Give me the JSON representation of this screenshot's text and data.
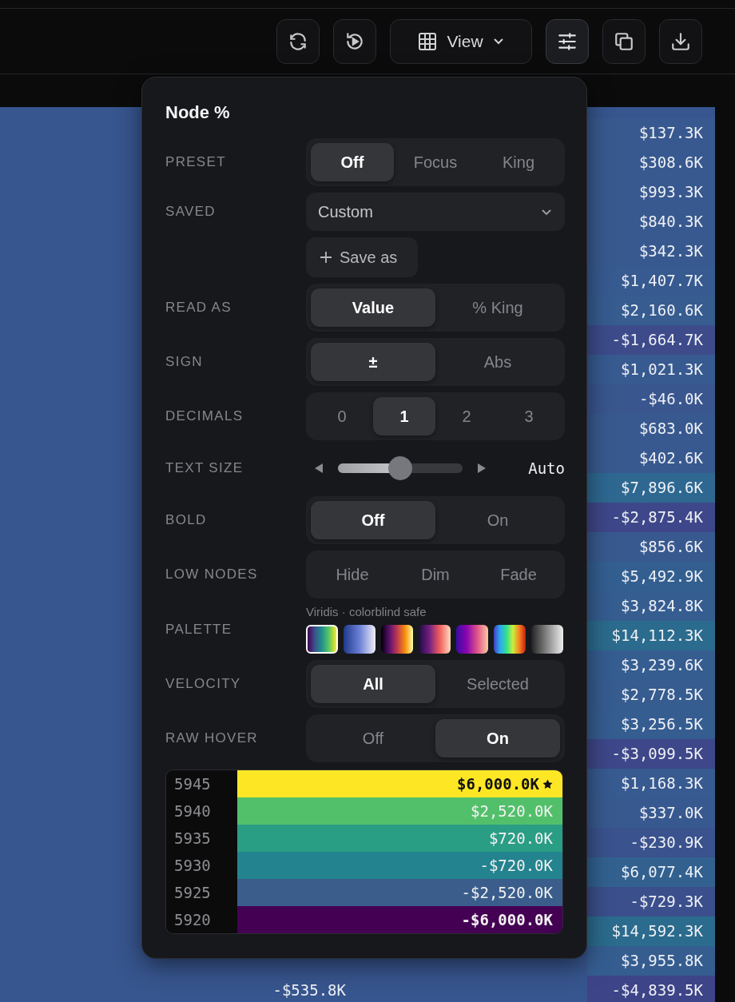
{
  "toolbar": {
    "buttons": [
      {
        "kind": "refresh",
        "selected": false
      },
      {
        "kind": "replay",
        "selected": false
      },
      {
        "kind": "view",
        "label": "View",
        "selected": false
      },
      {
        "kind": "adjust",
        "selected": true
      },
      {
        "kind": "copy",
        "selected": false
      },
      {
        "kind": "download",
        "selected": false
      }
    ]
  },
  "table": {
    "rows": [
      {
        "value": "$137.3K",
        "color": "#38598f"
      },
      {
        "value": "$308.6K",
        "color": "#38598f"
      },
      {
        "value": "$993.3K",
        "color": "#38598f"
      },
      {
        "value": "$840.3K",
        "color": "#38598f"
      },
      {
        "value": "$342.3K",
        "color": "#38598f"
      },
      {
        "value": "$1,407.7K",
        "color": "#375a90"
      },
      {
        "value": "$2,160.6K",
        "color": "#365c90"
      },
      {
        "value": "-$1,664.7K",
        "color": "#3d4b8b"
      },
      {
        "value": "$1,021.3K",
        "color": "#375a90"
      },
      {
        "value": "-$46.0K",
        "color": "#39568e"
      },
      {
        "value": "$683.0K",
        "color": "#38598f"
      },
      {
        "value": "$402.6K",
        "color": "#38598f"
      },
      {
        "value": "$7,896.6K",
        "color": "#2e6891"
      },
      {
        "value": "-$2,875.4K",
        "color": "#3e4789"
      },
      {
        "value": "$856.6K",
        "color": "#38598f"
      },
      {
        "value": "$5,492.9K",
        "color": "#335f90"
      },
      {
        "value": "$3,824.8K",
        "color": "#355d90"
      },
      {
        "value": "$14,112.3K",
        "color": "#2b6b8d"
      },
      {
        "value": "$3,239.6K",
        "color": "#355d90"
      },
      {
        "value": "$2,778.5K",
        "color": "#365c90"
      },
      {
        "value": "$3,256.5K",
        "color": "#355d90"
      },
      {
        "value": "-$3,099.5K",
        "color": "#3e4789"
      },
      {
        "value": "$1,168.3K",
        "color": "#375a90"
      },
      {
        "value": "$337.0K",
        "color": "#38598f"
      },
      {
        "value": "-$230.9K",
        "color": "#3a528d"
      },
      {
        "value": "$6,077.4K",
        "color": "#326190"
      },
      {
        "value": "-$729.3K",
        "color": "#3b4f8c"
      },
      {
        "value": "$14,592.3K",
        "color": "#2b6b8d"
      },
      {
        "value": "$3,955.8K",
        "color": "#355d90"
      },
      {
        "value": "-$4,839.5K",
        "color": "#3e4488",
        "left_value": "-$535.8K"
      }
    ]
  },
  "popover": {
    "title": "Node %",
    "settings": [
      {
        "kind": "segmented",
        "label": "PRESET",
        "options": [
          {
            "label": "Off",
            "selected": true
          },
          {
            "label": "Focus",
            "selected": false
          },
          {
            "label": "King",
            "selected": false
          }
        ]
      },
      {
        "kind": "select",
        "label": "SAVED",
        "value": "Custom"
      },
      {
        "kind": "button",
        "text": "Save as"
      },
      {
        "kind": "segmented",
        "label": "READ AS",
        "options": [
          {
            "label": "Value",
            "selected": true
          },
          {
            "label": "% King",
            "selected": false
          }
        ]
      },
      {
        "kind": "segmented",
        "label": "SIGN",
        "options": [
          {
            "label": "±",
            "selected": true
          },
          {
            "label": "Abs",
            "selected": false
          }
        ]
      },
      {
        "kind": "segmented",
        "label": "DECIMALS",
        "options": [
          {
            "label": "0",
            "selected": false
          },
          {
            "label": "1",
            "selected": true
          },
          {
            "label": "2",
            "selected": false
          },
          {
            "label": "3",
            "selected": false
          }
        ]
      },
      {
        "kind": "slider",
        "label": "TEXT SIZE",
        "level": 0.5,
        "reading": "Auto"
      },
      {
        "kind": "segmented",
        "label": "BOLD",
        "options": [
          {
            "label": "Off",
            "selected": true
          },
          {
            "label": "On",
            "selected": false
          }
        ]
      },
      {
        "kind": "segmented",
        "label": "LOW NODES",
        "options": [
          {
            "label": "Hide",
            "selected": false
          },
          {
            "label": "Dim",
            "selected": false
          },
          {
            "label": "Fade",
            "selected": false
          }
        ]
      },
      {
        "kind": "palette",
        "label": "PALETTE",
        "caption": "Viridis · colorblind safe",
        "swatches": [
          {
            "selected": true,
            "kind": "viridis"
          },
          {
            "selected": false,
            "kind": "blues"
          },
          {
            "selected": false,
            "kind": "inferno"
          },
          {
            "selected": false,
            "kind": "magma"
          },
          {
            "selected": false,
            "kind": "plasma"
          },
          {
            "selected": false,
            "kind": "rainbow"
          },
          {
            "selected": false,
            "kind": "greys"
          }
        ]
      },
      {
        "kind": "segmented",
        "label": "VELOCITY",
        "options": [
          {
            "label": "All",
            "selected": true
          },
          {
            "label": "Selected",
            "selected": false
          }
        ]
      },
      {
        "kind": "segmented",
        "label": "RAW HOVER",
        "options": [
          {
            "label": "Off",
            "selected": false
          },
          {
            "label": "On",
            "selected": true
          }
        ]
      }
    ],
    "legend": [
      {
        "index": "5945",
        "value": "$6,000.0K",
        "color": "#fde725",
        "bold": true,
        "starred": true
      },
      {
        "index": "5940",
        "value": "$2,520.0K",
        "color": "#52c06a",
        "bold": false
      },
      {
        "index": "5935",
        "value": "$720.0K",
        "color": "#2a9d85",
        "bold": false
      },
      {
        "index": "5930",
        "value": "-$720.0K",
        "color": "#23838e",
        "bold": false
      },
      {
        "index": "5925",
        "value": "-$2,520.0K",
        "color": "#3a5d8c",
        "bold": false
      },
      {
        "index": "5920",
        "value": "-$6,000.0K",
        "color": "#440154",
        "bold": true
      }
    ]
  }
}
